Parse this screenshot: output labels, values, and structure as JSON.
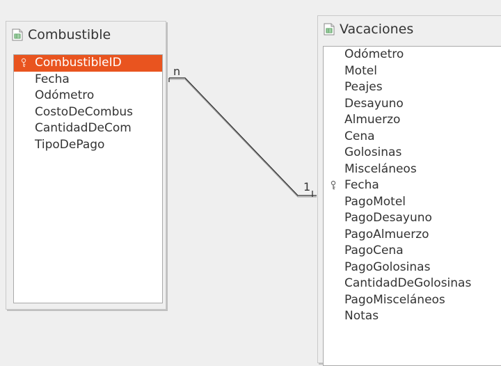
{
  "tables": {
    "combustible": {
      "title": "Combustible",
      "fields": [
        {
          "label": "CombustibleID",
          "primary_key": true,
          "selected": true
        },
        {
          "label": "Fecha",
          "primary_key": false,
          "selected": false
        },
        {
          "label": "Odómetro",
          "primary_key": false,
          "selected": false
        },
        {
          "label": "CostoDeCombus",
          "primary_key": false,
          "selected": false
        },
        {
          "label": "CantidadDeCom",
          "primary_key": false,
          "selected": false
        },
        {
          "label": "TipoDePago",
          "primary_key": false,
          "selected": false
        }
      ]
    },
    "vacaciones": {
      "title": "Vacaciones",
      "fields": [
        {
          "label": "Odómetro",
          "primary_key": false,
          "selected": false
        },
        {
          "label": "Motel",
          "primary_key": false,
          "selected": false
        },
        {
          "label": "Peajes",
          "primary_key": false,
          "selected": false
        },
        {
          "label": "Desayuno",
          "primary_key": false,
          "selected": false
        },
        {
          "label": "Almuerzo",
          "primary_key": false,
          "selected": false
        },
        {
          "label": "Cena",
          "primary_key": false,
          "selected": false
        },
        {
          "label": "Golosinas",
          "primary_key": false,
          "selected": false
        },
        {
          "label": "Misceláneos",
          "primary_key": false,
          "selected": false
        },
        {
          "label": "Fecha",
          "primary_key": true,
          "selected": false
        },
        {
          "label": "PagoMotel",
          "primary_key": false,
          "selected": false
        },
        {
          "label": "PagoDesayuno",
          "primary_key": false,
          "selected": false
        },
        {
          "label": "PagoAlmuerzo",
          "primary_key": false,
          "selected": false
        },
        {
          "label": "PagoCena",
          "primary_key": false,
          "selected": false
        },
        {
          "label": "PagoGolosinas",
          "primary_key": false,
          "selected": false
        },
        {
          "label": "CantidadDeGolosinas",
          "primary_key": false,
          "selected": false
        },
        {
          "label": "PagoMisceláneos",
          "primary_key": false,
          "selected": false
        },
        {
          "label": "Notas",
          "primary_key": false,
          "selected": false
        }
      ]
    }
  },
  "relation": {
    "source_cardinality": "n",
    "target_cardinality": "1"
  },
  "icons": {
    "table": "table-icon",
    "primary_key": "key-icon"
  },
  "colors": {
    "selection": "#e9541f",
    "background": "#efefef",
    "list_background": "#ffffff",
    "line": "#2f2f2f"
  }
}
